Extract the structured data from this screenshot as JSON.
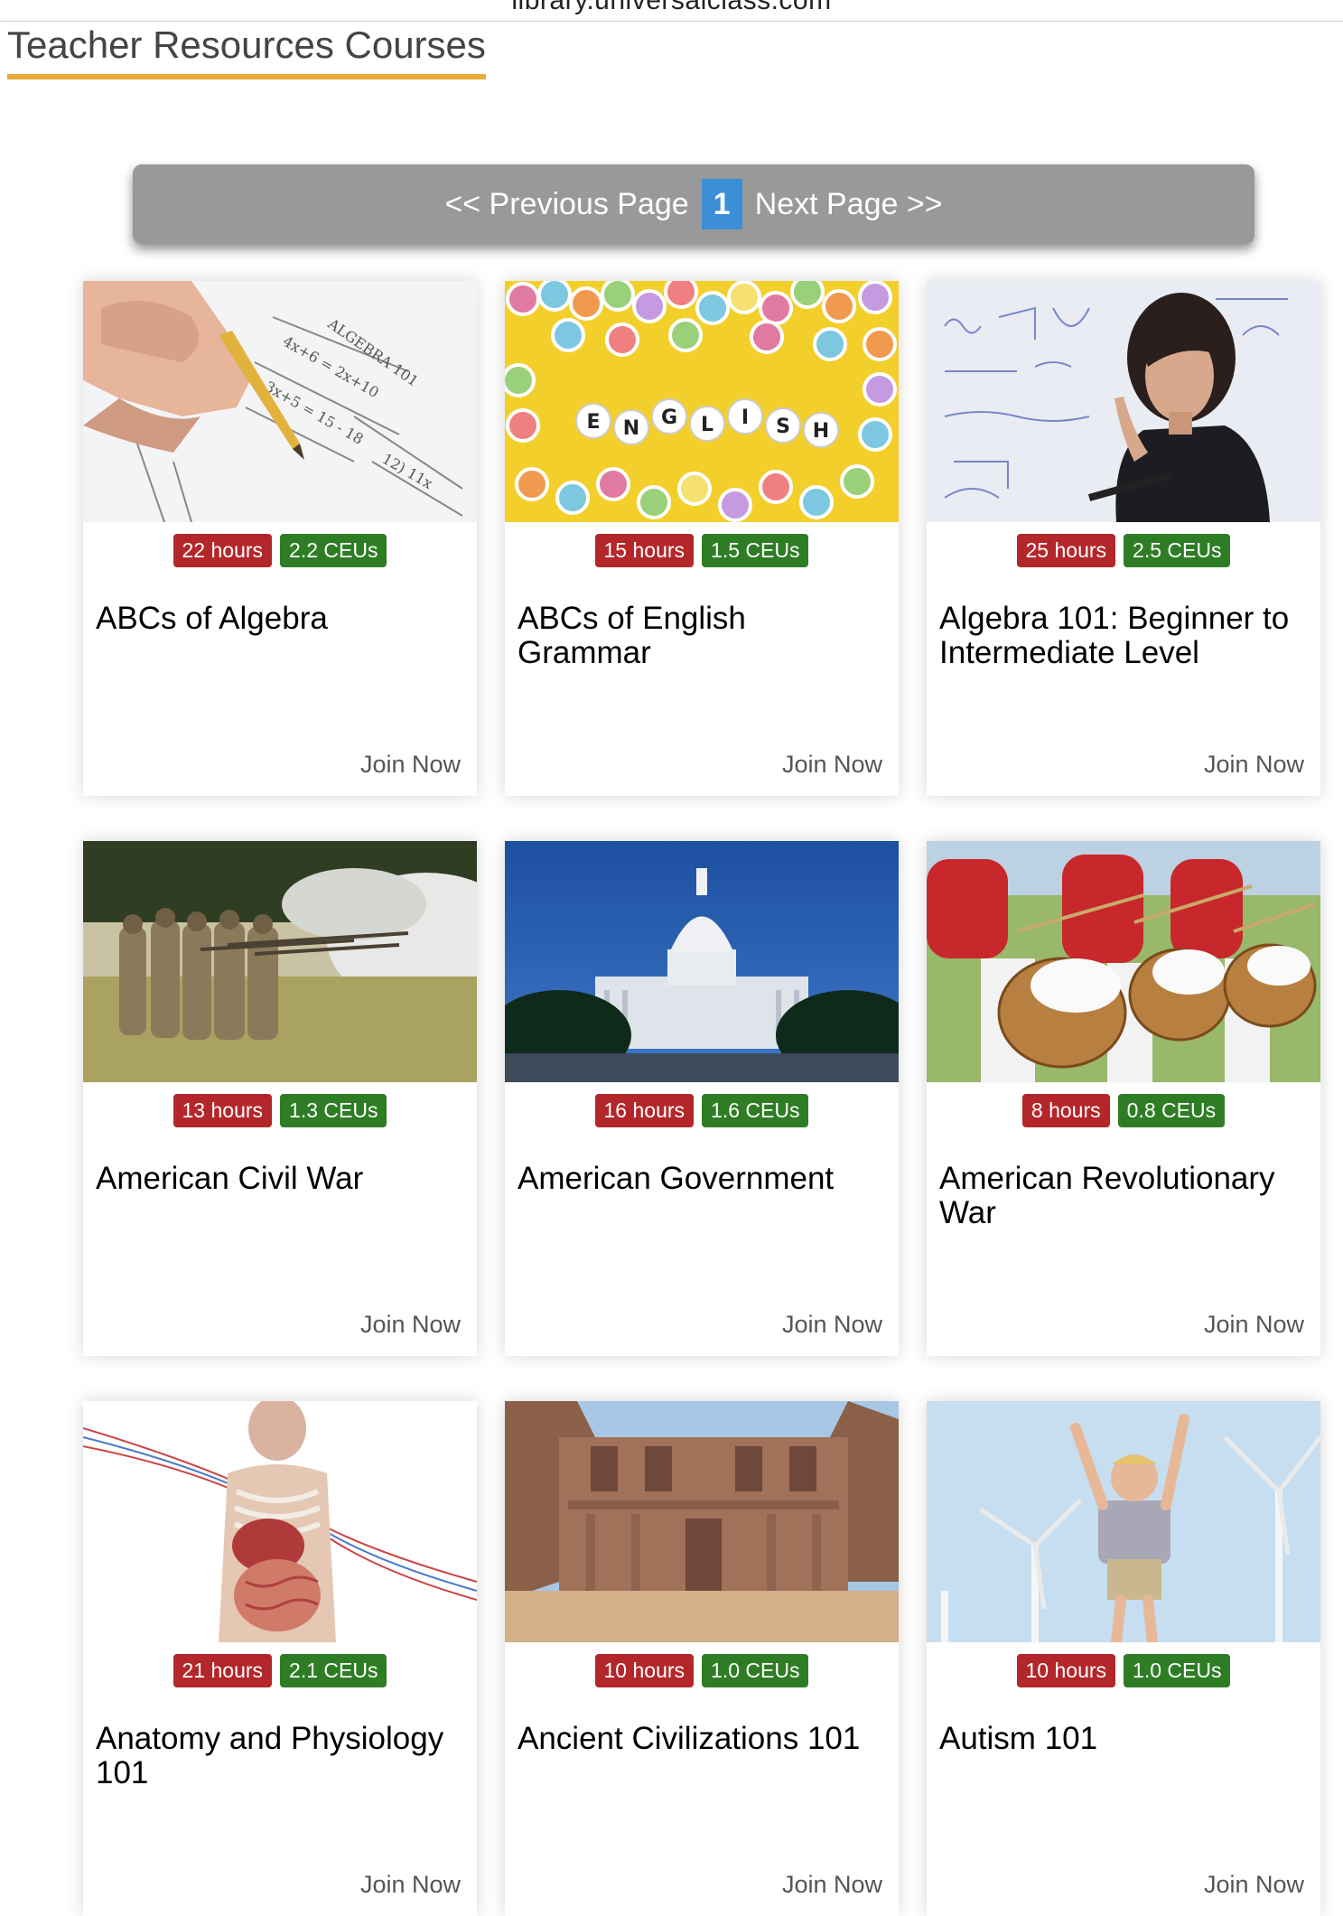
{
  "browser": {
    "url": "library.universalclass.com"
  },
  "header": {
    "title": "Teacher Resources Courses"
  },
  "pager": {
    "prev_label": "<< Previous Page",
    "current_page": "1",
    "next_label": "Next Page >>"
  },
  "colors": {
    "accent_underline": "#e8ab3a",
    "hours_badge": "#b3262a",
    "ceus_badge": "#2e7d25",
    "page_number": "#3b8fd7",
    "pager_bg": "#999999"
  },
  "courses": [
    {
      "hours": "22 hours",
      "ceus": "2.2 CEUs",
      "title": "ABCs of Algebra",
      "join": "Join Now",
      "image": "pencil-math-worksheet"
    },
    {
      "hours": "15 hours",
      "ceus": "1.5 CEUs",
      "title": "ABCs of English Grammar",
      "join": "Join Now",
      "image": "letter-beads"
    },
    {
      "hours": "25 hours",
      "ceus": "2.5 CEUs",
      "title": "Algebra 101: Beginner to Intermediate Level",
      "join": "Join Now",
      "image": "teacher-whiteboard"
    },
    {
      "hours": "13 hours",
      "ceus": "1.3 CEUs",
      "title": "American Civil War",
      "join": "Join Now",
      "image": "soldiers-firing"
    },
    {
      "hours": "16 hours",
      "ceus": "1.6 CEUs",
      "title": "American Government",
      "join": "Join Now",
      "image": "capitol-building"
    },
    {
      "hours": "8 hours",
      "ceus": "0.8 CEUs",
      "title": "American Revolutionary War",
      "join": "Join Now",
      "image": "drummers"
    },
    {
      "hours": "21 hours",
      "ceus": "2.1 CEUs",
      "title": "Anatomy and Physiology 101",
      "join": "Join Now",
      "image": "anatomy-figure"
    },
    {
      "hours": "10 hours",
      "ceus": "1.0 CEUs",
      "title": "Ancient Civilizations 101",
      "join": "Join Now",
      "image": "petra-ruins"
    },
    {
      "hours": "10 hours",
      "ceus": "1.0 CEUs",
      "title": "Autism 101",
      "join": "Join Now",
      "image": "child-wind-turbines"
    }
  ]
}
